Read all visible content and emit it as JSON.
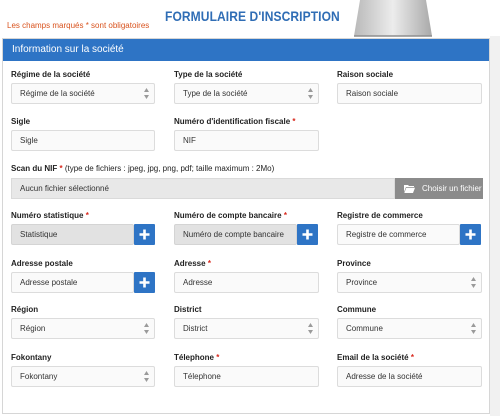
{
  "header": {
    "required_note": "Les champs marqués * sont obligatoires",
    "title": "FORMULAIRE D'INSCRIPTION"
  },
  "panel": {
    "title": "Information sur la société"
  },
  "fields": {
    "regime": {
      "label": "Régime de la société",
      "value": "Régime de la société"
    },
    "type": {
      "label": "Type de la société",
      "value": "Type de la société"
    },
    "raison": {
      "label": "Raison sociale",
      "value": "Raison sociale"
    },
    "sigle": {
      "label": "Sigle",
      "value": "Sigle"
    },
    "nif": {
      "label": "Numéro d'identification fiscale",
      "value": "NIF"
    },
    "scan": {
      "label": "Scan du NIF",
      "hint": "(type de fichiers : jpeg, jpg, png, pdf; taille maximum : 2Mo)",
      "value": "Aucun fichier sélectionné",
      "button": "Choisir un fichier"
    },
    "statistique": {
      "label": "Numéro statistique",
      "value": "Statistique"
    },
    "compte": {
      "label": "Numéro de compte bancaire",
      "value": "Numéro de compte bancaire"
    },
    "registre": {
      "label": "Registre de commerce",
      "value": "Registre de commerce"
    },
    "adresse_postale": {
      "label": "Adresse postale",
      "value": "Adresse postale"
    },
    "adresse": {
      "label": "Adresse",
      "value": "Adresse"
    },
    "province": {
      "label": "Province",
      "value": "Province"
    },
    "region": {
      "label": "Région",
      "value": "Région"
    },
    "district": {
      "label": "District",
      "value": "District"
    },
    "commune": {
      "label": "Commune",
      "value": "Commune"
    },
    "fokontany": {
      "label": "Fokontany",
      "value": "Fokontany"
    },
    "telephone": {
      "label": "Télephone",
      "value": "Télephone"
    },
    "email": {
      "label": "Email de la société",
      "value": "Adresse de la société"
    }
  },
  "icons": {
    "plus": "plus-icon",
    "select_arrows": "select-arrows-icon",
    "folder": "folder-open-icon"
  },
  "colors": {
    "accent": "#2e74c5",
    "required": "#d9291e",
    "note": "#d9531e",
    "file_button": "#8b8b8b"
  }
}
